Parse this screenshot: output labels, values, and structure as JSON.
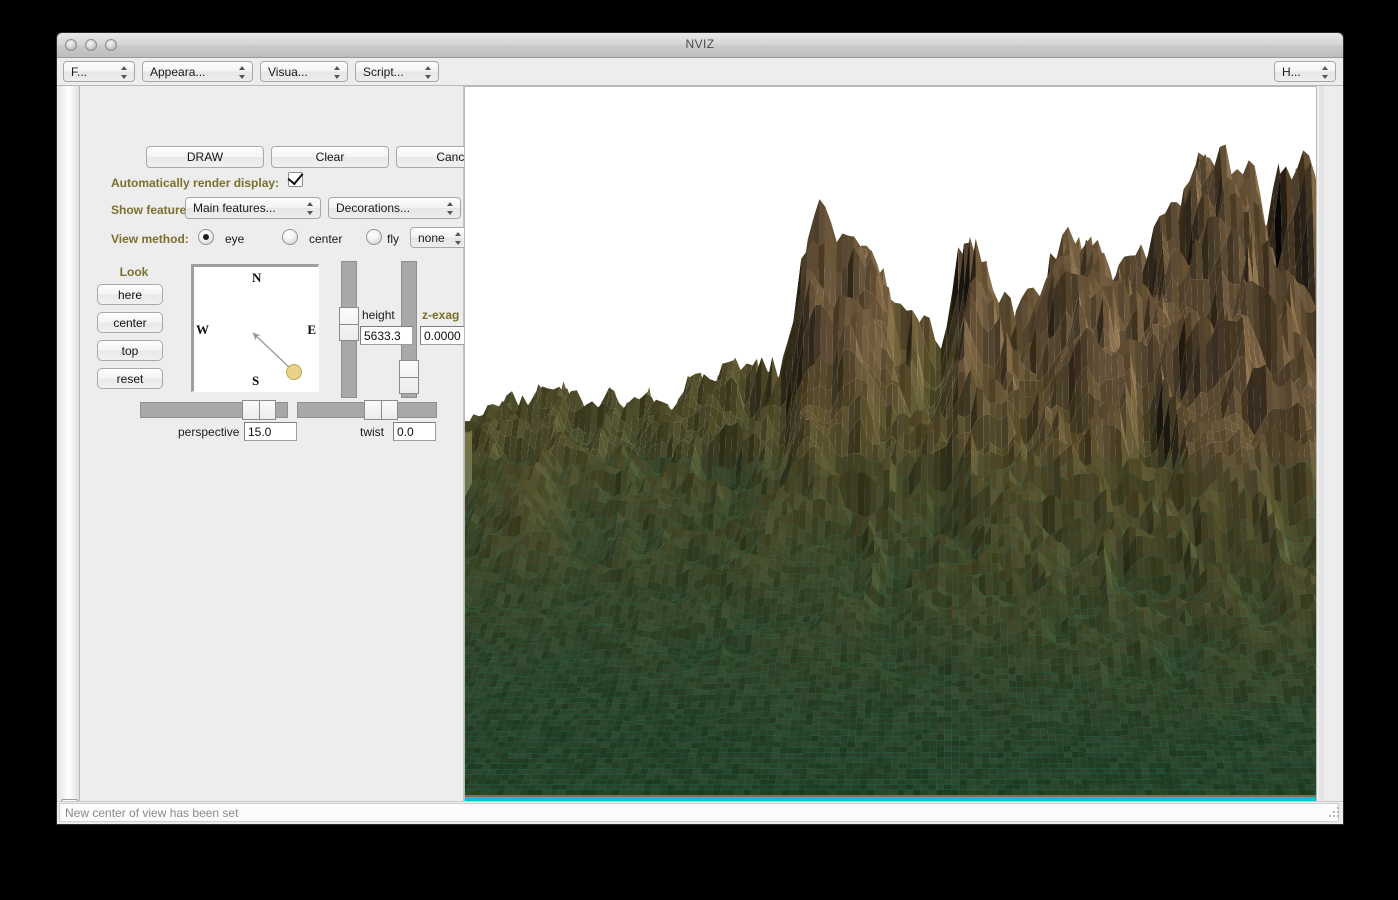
{
  "window": {
    "title": "NVIZ",
    "traffic_lights": [
      "close",
      "minimize",
      "maximize"
    ]
  },
  "menubar": {
    "items": [
      {
        "label": "F...",
        "name": "file-menu"
      },
      {
        "label": "Appeara...",
        "name": "appearance-menu"
      },
      {
        "label": "Visua...",
        "name": "visualize-menu"
      },
      {
        "label": "Script...",
        "name": "scripting-menu"
      }
    ],
    "help": {
      "label": "H...",
      "name": "help-menu"
    }
  },
  "actions": {
    "draw": "DRAW",
    "clear": "Clear",
    "cancel": "Cancel"
  },
  "autorender": {
    "label": "Automatically render display:",
    "checked": true
  },
  "show_features": {
    "label": "Show features:",
    "main": "Main features...",
    "decorations": "Decorations..."
  },
  "view_method": {
    "label": "View method:",
    "options": [
      "eye",
      "center",
      "fly"
    ],
    "selected": "eye",
    "fly_mode": "none"
  },
  "look": {
    "title": "Look",
    "buttons": [
      "here",
      "center",
      "top",
      "reset"
    ]
  },
  "compass": {
    "north": "N",
    "south": "S",
    "west": "W",
    "east": "E",
    "handle_color": "#e8d388",
    "arrow_color": "#9a9a9a"
  },
  "sliders": {
    "height": {
      "label": "height",
      "value": "5633.3"
    },
    "zexag": {
      "label": "z-exag",
      "value": "0.0000"
    },
    "perspective": {
      "label": "perspective",
      "value": "15.0"
    },
    "twist": {
      "label": "twist",
      "value": "0.0"
    }
  },
  "statusbar": {
    "message": "New center of view has been set"
  },
  "render": {
    "background": "#ffffff",
    "water_color": "#00c7d3",
    "rock_high": "#9c8a5c",
    "rock_mid": "#86794c",
    "vegetation": "#4f7a46",
    "shadow": "#16170f",
    "highlight": "#c9bd8a"
  }
}
